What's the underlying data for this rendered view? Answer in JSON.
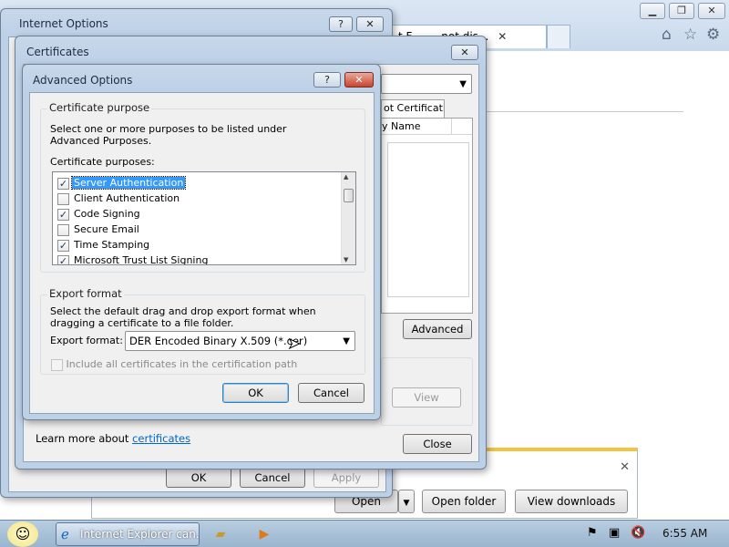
{
  "taskbar": {
    "ie_task_label": "Internet Explorer can...",
    "clock": "6:55 AM"
  },
  "browser": {
    "tab1_title": "...t Ex...not dis...",
    "tab1_visible_text": "t F",
    "tab1_visible_text2": "not dis...",
    "download_bar": {
      "open_label": "Open",
      "open_folder_label": "Open folder",
      "view_downloads_label": "View downloads"
    }
  },
  "internet_options": {
    "title": "Internet Options",
    "ok_label": "OK",
    "cancel_label": "Cancel",
    "apply_label": "Apply"
  },
  "certificates": {
    "title": "Certificates",
    "tab_partial": "ot Certification",
    "column_partial": "y Name",
    "advanced_label": "Advanced",
    "view_label": "View",
    "learn_more_text": "Learn more about ",
    "learn_more_link": "certificates",
    "close_label": "Close"
  },
  "advanced_options": {
    "title": "Advanced Options",
    "help_label": "?",
    "certificate_purpose_group": "Certificate purpose",
    "purpose_description": "Select one or more purposes to be listed under Advanced Purposes.",
    "purposes_label": "Certificate purposes:",
    "purposes": [
      {
        "label": "Server Authentication",
        "checked": true,
        "selected": true
      },
      {
        "label": "Client Authentication",
        "checked": false,
        "selected": false
      },
      {
        "label": "Code Signing",
        "checked": true,
        "selected": false
      },
      {
        "label": "Secure Email",
        "checked": false,
        "selected": false
      },
      {
        "label": "Time Stamping",
        "checked": true,
        "selected": false
      },
      {
        "label": "Microsoft Trust List Signing",
        "checked": true,
        "selected": false
      }
    ],
    "export_group": "Export format",
    "export_description": "Select the default drag and drop export format when dragging a certificate to a file folder.",
    "export_format_label": "Export format:",
    "export_format_value": "DER Encoded Binary X.509 (*.cer)",
    "include_all_label": "Include all certificates in the certification path",
    "ok_label": "OK",
    "cancel_label": "Cancel"
  },
  "colors": {
    "selection": "#3399ff",
    "link": "#0066cc",
    "dialog_frame": "#bcd0e6"
  }
}
